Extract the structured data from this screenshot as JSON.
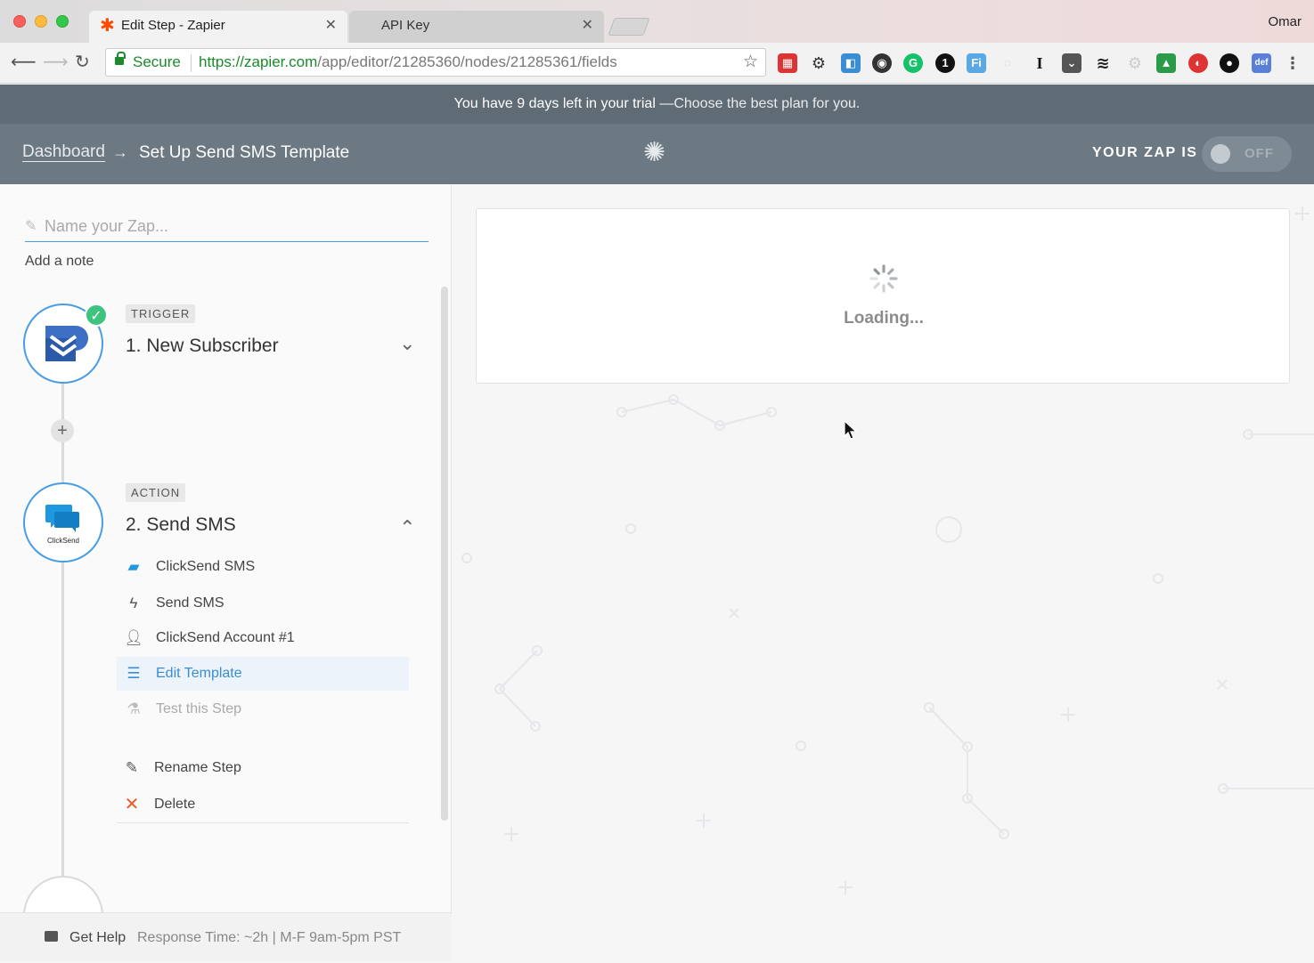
{
  "browser": {
    "tabs": [
      {
        "label": "Edit Step - Zapier",
        "active": true
      },
      {
        "label": "API Key",
        "active": false
      }
    ],
    "user": "Omar",
    "secure_label": "Secure",
    "url_host": "https://zapier.com",
    "url_path": "/app/editor/21285360/nodes/21285361/fields",
    "extensions": [
      "calendar-ext-2",
      "gear-ext",
      "window-ext",
      "camera-ext",
      "grammarly-ext",
      "onepassword-ext",
      "fi-ext",
      "swirl-ext",
      "instapaper-ext",
      "pocket-ext",
      "buffer-ext",
      "gear-gray-ext",
      "drive-ext",
      "lastpass-ext-1",
      "ninja-ext",
      "def-ext"
    ]
  },
  "trial": {
    "text": "You have 9 days left in your trial —",
    "cta": "Choose the best plan for you."
  },
  "header": {
    "dashboard_link": "Dashboard",
    "arrow": "→",
    "title": "Set Up Send SMS Template",
    "zap_is_label": "YOUR ZAP IS",
    "toggle_label": "OFF"
  },
  "sidebar": {
    "name_placeholder": "Name your Zap...",
    "add_note": "Add a note",
    "trigger": {
      "badge": "TRIGGER",
      "title": "1. New Subscriber"
    },
    "action": {
      "badge": "ACTION",
      "title": "2. Send SMS",
      "app_logo_text": "ClickSend",
      "substeps": [
        {
          "label": "ClickSend SMS",
          "icon": "clicksend-icon",
          "state": "normal"
        },
        {
          "label": "Send SMS",
          "icon": "bolt-icon",
          "state": "normal"
        },
        {
          "label": "ClickSend Account #1",
          "icon": "user-icon",
          "state": "normal"
        },
        {
          "label": "Edit Template",
          "icon": "lines-icon",
          "state": "active"
        },
        {
          "label": "Test this Step",
          "icon": "flask-icon",
          "state": "disabled"
        }
      ],
      "rename": "Rename Step",
      "delete": "Delete"
    }
  },
  "help": {
    "label": "Get Help",
    "response": "Response Time: ~2h | M-F 9am-5pm PST"
  },
  "main": {
    "loading_text": "Loading..."
  },
  "colors": {
    "accent": "#4a9de3",
    "header_bg": "#6c7982",
    "trial_bg": "#5f6b75",
    "success": "#3ec47e",
    "delete": "#f05a28"
  }
}
